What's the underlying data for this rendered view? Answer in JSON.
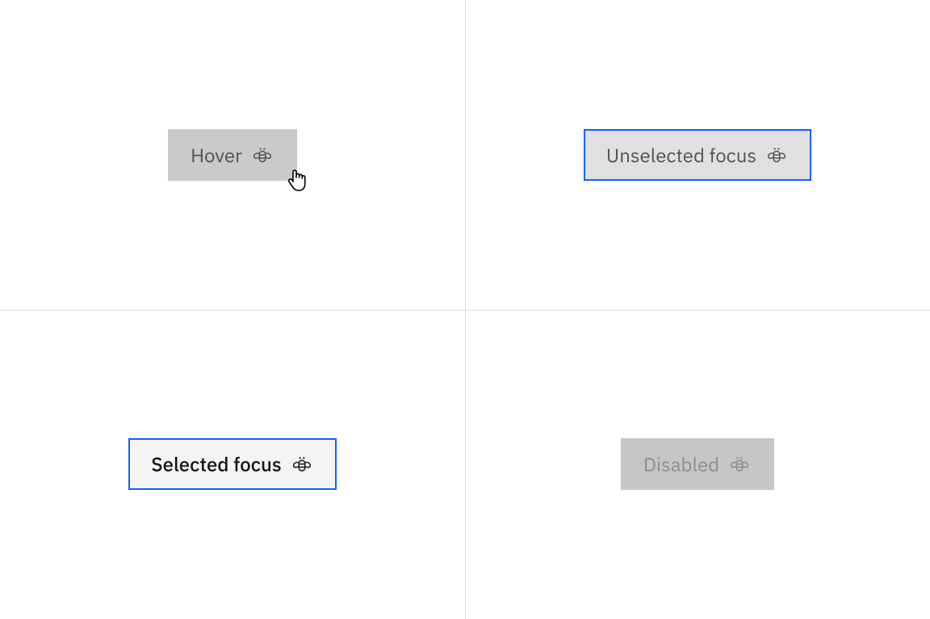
{
  "states": {
    "hover": {
      "label": "Hover"
    },
    "unselected_focus": {
      "label": "Unselected focus"
    },
    "selected_focus": {
      "label": "Selected focus"
    },
    "disabled": {
      "label": "Disabled"
    }
  },
  "colors": {
    "focus_border": "#0f62fe",
    "hover_bg": "#cacaca",
    "unselected_bg": "#e0e0e0",
    "selected_bg": "#f4f4f4",
    "disabled_bg": "#c6c6c6",
    "text_secondary": "#525252",
    "text_primary": "#161616",
    "text_disabled": "#8d8d8d",
    "divider": "#dcdcdc"
  }
}
